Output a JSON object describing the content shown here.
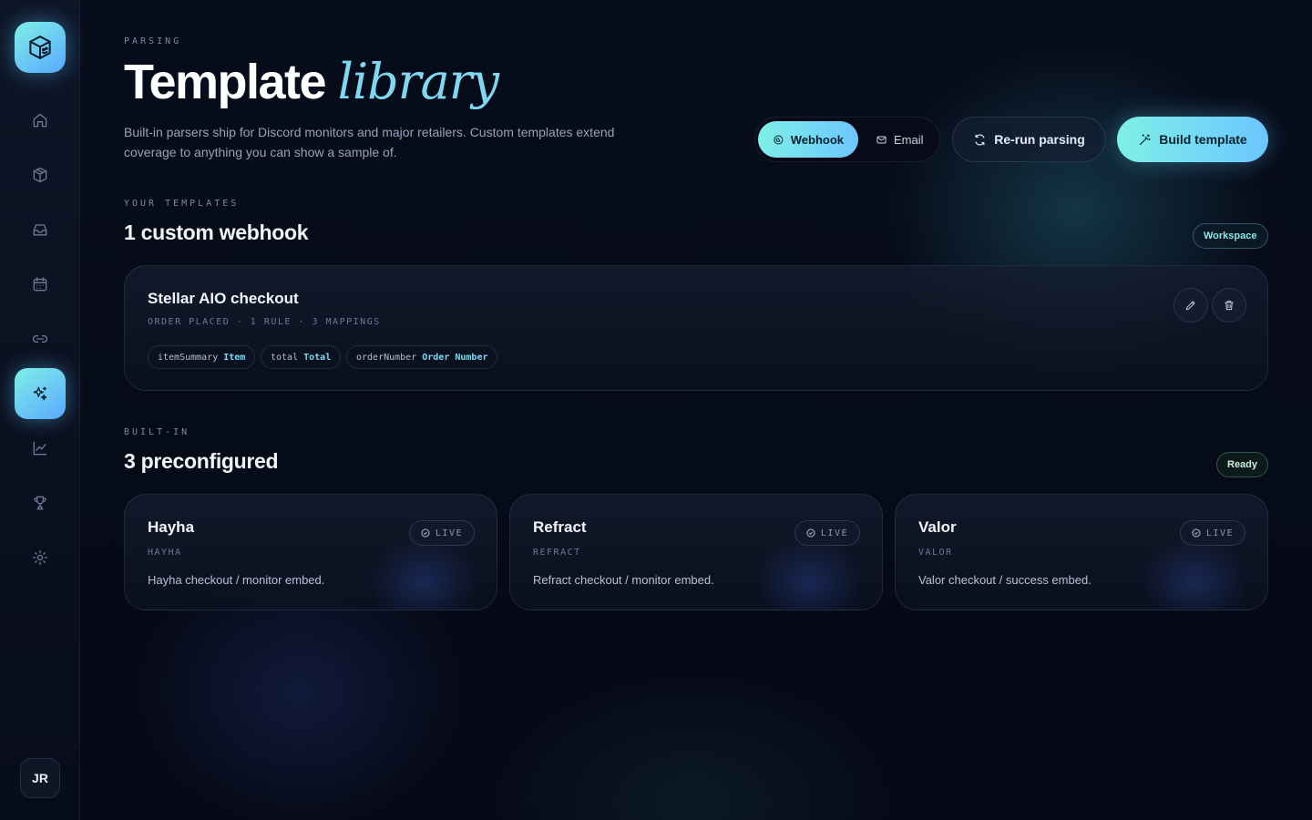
{
  "sidebar": {
    "logo_icon": "cube-logo-icon",
    "items": [
      {
        "icon": "home-icon",
        "active": false
      },
      {
        "icon": "package-icon",
        "active": false
      },
      {
        "icon": "inbox-icon",
        "active": false
      },
      {
        "icon": "calendar-icon",
        "active": false
      },
      {
        "icon": "link-icon",
        "active": false
      },
      {
        "icon": "sparkles-icon",
        "active": true
      },
      {
        "icon": "chart-icon",
        "active": false
      },
      {
        "icon": "trophy-icon",
        "active": false
      },
      {
        "icon": "gear-icon",
        "active": false
      }
    ],
    "avatar_initials": "JR"
  },
  "header": {
    "eyebrow": "PARSING",
    "title_main": "Template",
    "title_accent": "library",
    "description": "Built-in parsers ship for Discord monitors and major retailers. Custom templates extend coverage to anything you can show a sample of.",
    "source_toggle": {
      "options": [
        "Webhook",
        "Email"
      ],
      "selected": "Webhook"
    },
    "rerun_label": "Re-run parsing",
    "build_label": "Build template"
  },
  "custom": {
    "eyebrow": "YOUR TEMPLATES",
    "title": "1 custom webhook",
    "badge": "Workspace",
    "templates": [
      {
        "name": "Stellar AIO checkout",
        "meta": "ORDER PLACED · 1 RULE · 3 MAPPINGS",
        "mappings": [
          {
            "key": "itemSummary",
            "value": "Item"
          },
          {
            "key": "total",
            "value": "Total"
          },
          {
            "key": "orderNumber",
            "value": "Order Number"
          }
        ]
      }
    ]
  },
  "builtin": {
    "eyebrow": "BUILT-IN",
    "title": "3 preconfigured",
    "badge": "Ready",
    "live_label": "LIVE",
    "templates": [
      {
        "name": "Hayha",
        "code": "HAYHA",
        "description": "Hayha checkout / monitor embed."
      },
      {
        "name": "Refract",
        "code": "REFRACT",
        "description": "Refract checkout / monitor embed."
      },
      {
        "name": "Valor",
        "code": "VALOR",
        "description": "Valor checkout / success embed."
      }
    ]
  },
  "colors": {
    "accent_start": "#7ef0e6",
    "accent_end": "#6cc6ff",
    "background": "#060b18"
  }
}
